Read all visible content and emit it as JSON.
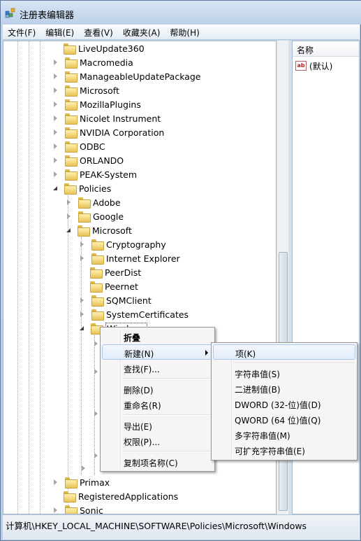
{
  "window": {
    "title": "注册表编辑器"
  },
  "menubar": [
    "文件(F)",
    "编辑(E)",
    "查看(V)",
    "收藏夹(A)",
    "帮助(H)"
  ],
  "tree": [
    {
      "label": "LiveUpdate360",
      "expander": "none"
    },
    {
      "label": "Macromedia",
      "expander": "closed"
    },
    {
      "label": "ManageableUpdatePackage",
      "expander": "closed"
    },
    {
      "label": "Microsoft",
      "expander": "closed"
    },
    {
      "label": "MozillaPlugins",
      "expander": "closed"
    },
    {
      "label": "Nicolet Instrument",
      "expander": "closed"
    },
    {
      "label": "NVIDIA Corporation",
      "expander": "closed"
    },
    {
      "label": "ODBC",
      "expander": "closed"
    },
    {
      "label": "ORLANDO",
      "expander": "closed"
    },
    {
      "label": "PEAK-System",
      "expander": "closed"
    },
    {
      "label": "Policies",
      "expander": "open"
    },
    {
      "label": "Adobe",
      "expander": "closed"
    },
    {
      "label": "Google",
      "expander": "closed"
    },
    {
      "label": "Microsoft",
      "expander": "open"
    },
    {
      "label": "Cryptography",
      "expander": "closed"
    },
    {
      "label": "Internet Explorer",
      "expander": "closed"
    },
    {
      "label": "PeerDist",
      "expander": "none"
    },
    {
      "label": "Peernet",
      "expander": "none"
    },
    {
      "label": "SQMClient",
      "expander": "closed"
    },
    {
      "label": "SystemCertificates",
      "expander": "closed"
    },
    {
      "label": "Windows",
      "expander": "open"
    },
    {
      "label": "Primax",
      "expander": "closed"
    },
    {
      "label": "RegisteredApplications",
      "expander": "none"
    },
    {
      "label": "Sonic",
      "expander": "closed"
    }
  ],
  "list": {
    "column_name": "名称",
    "rows": [
      {
        "name": "(默认)",
        "icon": "string-value-icon"
      }
    ]
  },
  "context_menu": {
    "items": [
      "折叠",
      "新建(N)",
      "查找(F)...",
      "删除(D)",
      "重命名(R)",
      "导出(E)",
      "权限(P)...",
      "复制项名称(C)"
    ]
  },
  "submenu": {
    "items": [
      "项(K)",
      "字符串值(S)",
      "二进制值(B)",
      "DWORD (32-位)值(D)",
      "QWORD (64 位)值(Q)",
      "多字符串值(M)",
      "可扩充字符串值(E)"
    ]
  },
  "status": {
    "path": "计算机\\HKEY_LOCAL_MACHINE\\SOFTWARE\\Policies\\Microsoft\\Windows"
  }
}
